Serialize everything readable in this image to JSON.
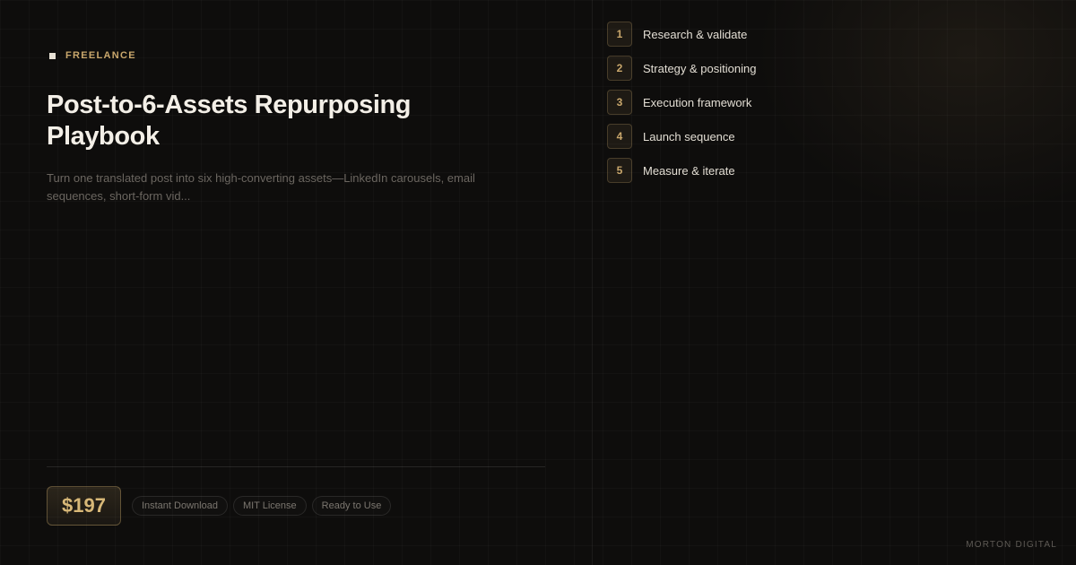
{
  "category": {
    "label": "FREELANCE"
  },
  "product": {
    "title": "Post-to-6-Assets Repurposing Playbook",
    "description": "Turn one translated post into six high-converting assets—LinkedIn carousels, email sequences, short-form vid...",
    "price": "$197",
    "tags": [
      "Instant Download",
      "MIT License",
      "Ready to Use"
    ]
  },
  "steps": [
    {
      "number": "1",
      "label": "Research & validate"
    },
    {
      "number": "2",
      "label": "Strategy & positioning"
    },
    {
      "number": "3",
      "label": "Execution framework"
    },
    {
      "number": "4",
      "label": "Launch sequence"
    },
    {
      "number": "5",
      "label": "Measure & iterate"
    }
  ],
  "brand": {
    "name": "MORTON DIGITAL"
  },
  "colors": {
    "background": "#0e0d0c",
    "accent": "#c9a76c",
    "title": "#f3efe7",
    "muted": "#6b6660"
  }
}
